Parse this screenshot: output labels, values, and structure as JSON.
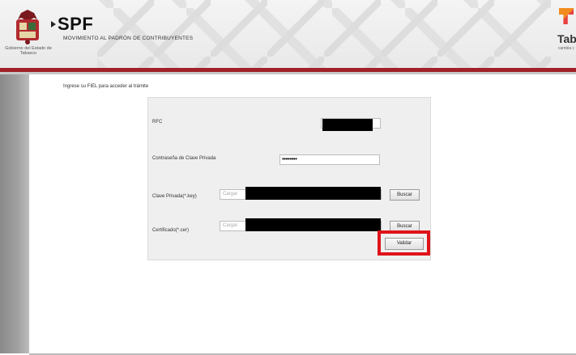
{
  "header": {
    "seal_text": "Gobierno del Estado de Tabasco",
    "app_title": "SPF",
    "app_subtitle": "MOVIMIENTO AL PADRÓN DE CONTRIBUYENTES",
    "brand_name": "Taba",
    "brand_tagline": "cambia c",
    "brand_colors": [
      "#a02127",
      "#f28c1f",
      "#e8423f"
    ]
  },
  "form": {
    "instruction": "Ingrese su FIEL para acceder al trámite",
    "rfc_label": "RFC",
    "password_label": "Contraseña de Clave Privada",
    "password_value": "••••••••",
    "private_key_label": "Clave Privada(*.key)",
    "private_key_placeholder": "Cargar",
    "certificate_label": "Certificado(*.cer)",
    "certificate_placeholder": "Cargar",
    "browse_label": "Buscar",
    "submit_label": "Validar"
  }
}
